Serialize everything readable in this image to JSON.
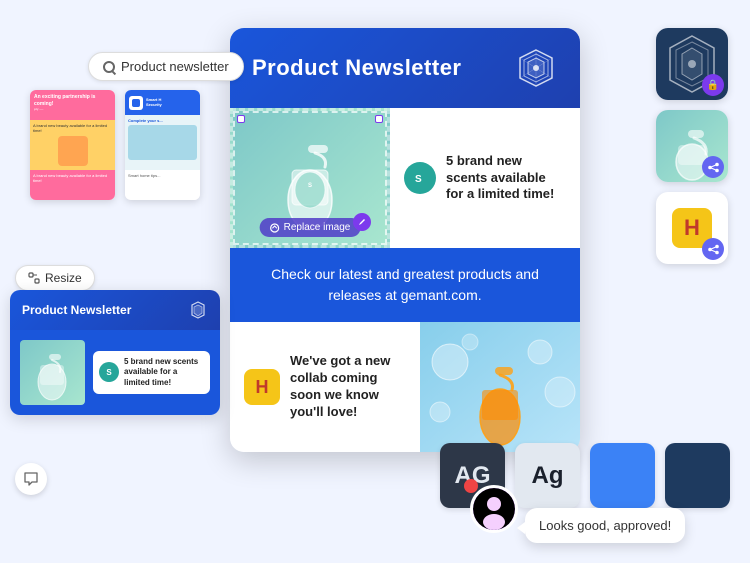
{
  "search": {
    "placeholder": "Product newsletter",
    "value": "Product newsletter"
  },
  "template_card1": {
    "header": "An exciting partnership is coming!",
    "body": "A brand new beauty available for a limited time!"
  },
  "template_card2": {
    "header": "Smart Home Security",
    "body": "Complete your s..."
  },
  "resize_btn": {
    "label": "Resize"
  },
  "main_card": {
    "title": "Product Newsletter",
    "section1_text": "5 brand new scents available for a limited time!",
    "section2_text": "Check our latest and greatest products and releases at gemant.com.",
    "section3_text": "We've got a new collab coming soon we know you'll love!",
    "replace_image_btn": "Replace image"
  },
  "small_preview": {
    "title": "Product Newsletter",
    "scent_text": "5 brand new scents available for a limited time!"
  },
  "speech_bubble": {
    "text": "Looks good, approved!"
  },
  "bottom_icons": {
    "ag_dark": "AG",
    "ag_light": "Ag"
  }
}
